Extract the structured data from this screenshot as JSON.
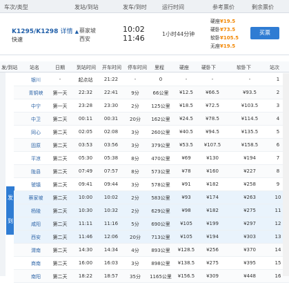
{
  "header": {
    "cols": [
      "车次/类型",
      "发站/到站",
      "发车/到时",
      "运行时间",
      "参考票价",
      "剩余票价"
    ]
  },
  "train": {
    "number": "K1295/K1298",
    "details": "详情",
    "arrow": "▲",
    "type": "快速",
    "from": "蔡家坡",
    "to": "西安",
    "dep": "10:02",
    "arr": "11:46",
    "duration": "1小时44分钟",
    "prices": [
      {
        "cls": "硬座",
        "val": "¥19.5"
      },
      {
        "cls": "硬卧",
        "val": "¥73.5"
      },
      {
        "cls": "软卧",
        "val": "¥105.5"
      },
      {
        "cls": "无座",
        "val": "¥19.5"
      }
    ],
    "buy": "买票"
  },
  "stops_header": {
    "route": "发/到站",
    "cols": [
      "站名",
      "日期",
      "到站时间",
      "开车时间",
      "停车时间",
      "里程",
      "硬座",
      "硬卧下",
      "软卧下",
      "站次"
    ]
  },
  "route_tag": [
    "发",
    "到"
  ],
  "stops": [
    {
      "name": "银川",
      "date": "-",
      "arr": "起点站",
      "dep": "21:22",
      "stay": "-",
      "km": "0",
      "yz": "-",
      "ywx": "-",
      "rwx": "-",
      "n": "1"
    },
    {
      "name": "青铜峡",
      "date": "第一天",
      "arr": "22:32",
      "dep": "22:41",
      "stay": "9分",
      "km": "66公里",
      "yz": "¥12.5",
      "ywx": "¥66.5",
      "rwx": "¥93.5",
      "n": "2"
    },
    {
      "name": "中宁",
      "date": "第一天",
      "arr": "23:28",
      "dep": "23:30",
      "stay": "2分",
      "km": "125公里",
      "yz": "¥18.5",
      "ywx": "¥72.5",
      "rwx": "¥103.5",
      "n": "3"
    },
    {
      "name": "中卫",
      "date": "第二天",
      "arr": "00:11",
      "dep": "00:31",
      "stay": "20分",
      "km": "162公里",
      "yz": "¥24.5",
      "ywx": "¥78.5",
      "rwx": "¥114.5",
      "n": "4"
    },
    {
      "name": "同心",
      "date": "第二天",
      "arr": "02:05",
      "dep": "02:08",
      "stay": "3分",
      "km": "260公里",
      "yz": "¥40.5",
      "ywx": "¥94.5",
      "rwx": "¥135.5",
      "n": "5"
    },
    {
      "name": "固原",
      "date": "第二天",
      "arr": "03:53",
      "dep": "03:56",
      "stay": "3分",
      "km": "379公里",
      "yz": "¥53.5",
      "ywx": "¥107.5",
      "rwx": "¥158.5",
      "n": "6"
    },
    {
      "name": "平凉",
      "date": "第二天",
      "arr": "05:30",
      "dep": "05:38",
      "stay": "8分",
      "km": "470公里",
      "yz": "¥69",
      "ywx": "¥130",
      "rwx": "¥194",
      "n": "7"
    },
    {
      "name": "陇县",
      "date": "第二天",
      "arr": "07:49",
      "dep": "07:57",
      "stay": "8分",
      "km": "573公里",
      "yz": "¥78",
      "ywx": "¥160",
      "rwx": "¥227",
      "n": "8"
    },
    {
      "name": "虢镇",
      "date": "第二天",
      "arr": "09:41",
      "dep": "09:44",
      "stay": "3分",
      "km": "578公里",
      "yz": "¥91",
      "ywx": "¥182",
      "rwx": "¥258",
      "n": "9"
    },
    {
      "name": "蔡家坡",
      "date": "第二天",
      "arr": "10:00",
      "dep": "10:02",
      "stay": "2分",
      "km": "583公里",
      "yz": "¥93",
      "ywx": "¥174",
      "rwx": "¥263",
      "n": "10"
    },
    {
      "name": "杨陵",
      "date": "第二天",
      "arr": "10:30",
      "dep": "10:32",
      "stay": "2分",
      "km": "629公里",
      "yz": "¥98",
      "ywx": "¥182",
      "rwx": "¥275",
      "n": "11"
    },
    {
      "name": "咸阳",
      "date": "第二天",
      "arr": "11:11",
      "dep": "11:16",
      "stay": "5分",
      "km": "690公里",
      "yz": "¥105",
      "ywx": "¥199",
      "rwx": "¥297",
      "n": "12"
    },
    {
      "name": "西安",
      "date": "第二天",
      "arr": "11:46",
      "dep": "12:06",
      "stay": "20分",
      "km": "713公里",
      "yz": "¥105",
      "ywx": "¥194",
      "rwx": "¥303",
      "n": "13"
    },
    {
      "name": "渭南",
      "date": "第二天",
      "arr": "14:30",
      "dep": "14:34",
      "stay": "4分",
      "km": "893公里",
      "yz": "¥128.5",
      "ywx": "¥256",
      "rwx": "¥370",
      "n": "14"
    },
    {
      "name": "商南",
      "date": "第二天",
      "arr": "16:00",
      "dep": "16:03",
      "stay": "3分",
      "km": "898公里",
      "yz": "¥138.5",
      "ywx": "¥275",
      "rwx": "¥395",
      "n": "15"
    },
    {
      "name": "南阳",
      "date": "第二天",
      "arr": "18:22",
      "dep": "18:57",
      "stay": "35分",
      "km": "1165公里",
      "yz": "¥156.5",
      "ywx": "¥309",
      "rwx": "¥448",
      "n": "16"
    }
  ]
}
